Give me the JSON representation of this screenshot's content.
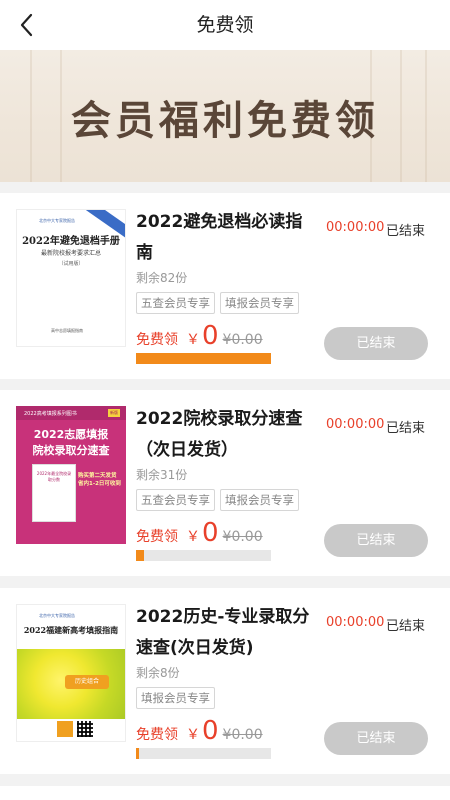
{
  "header": {
    "title": "免费领",
    "back_icon": "chevron-left-icon"
  },
  "banner": {
    "title": "会员福利免费领"
  },
  "items": [
    {
      "title": "2022避免退档必读指南",
      "remaining": "剩余82份",
      "tags": [
        "五查会员专享",
        "填报会员专享"
      ],
      "free_label": "免费领",
      "currency": "￥",
      "price": "0",
      "original_price": "¥0.00",
      "progress": 1.0,
      "countdown": "00:00:00",
      "status": "已结束",
      "button_label": "已结束",
      "thumb": {
        "publisher": "北京中大专家院报告",
        "headline": "2022年避免退档手册",
        "sub": "最新院校报考要求汇总",
        "sub2": "（试用版）",
        "footer": "高中志愿填报指南"
      }
    },
    {
      "title": "2022院校录取分速查（次日发货）",
      "remaining": "剩余31份",
      "tags": [
        "五查会员专享",
        "填报会员专享"
      ],
      "free_label": "免费领",
      "currency": "￥",
      "price": "0",
      "original_price": "¥0.00",
      "progress": 0.06,
      "countdown": "00:00:00",
      "status": "已结束",
      "button_label": "已结束",
      "thumb": {
        "topline": "2022高考填报系列图书",
        "badge": "新版",
        "line1": "2022志愿填报",
        "line2": "院校录取分速查",
        "inner": "2022年最全院校录取分数",
        "promo": "购买第二天发货\n省内1-2日可收到"
      }
    },
    {
      "title": "2022历史-专业录取分速查(次日发货)",
      "remaining": "剩余8份",
      "tags": [
        "填报会员专享"
      ],
      "free_label": "免费领",
      "currency": "￥",
      "price": "0",
      "original_price": "¥0.00",
      "progress": 0.02,
      "countdown": "00:00:00",
      "status": "已结束",
      "button_label": "已结束",
      "thumb": {
        "publisher": "北京中大专家院报告",
        "headline": "2022福建新高考填报指南",
        "sub": "历史组合",
        "button": "历史组合"
      }
    }
  ],
  "colors": {
    "accent": "#e8402a",
    "progress": "#f28a1a",
    "disabled": "#c9c9c9"
  }
}
